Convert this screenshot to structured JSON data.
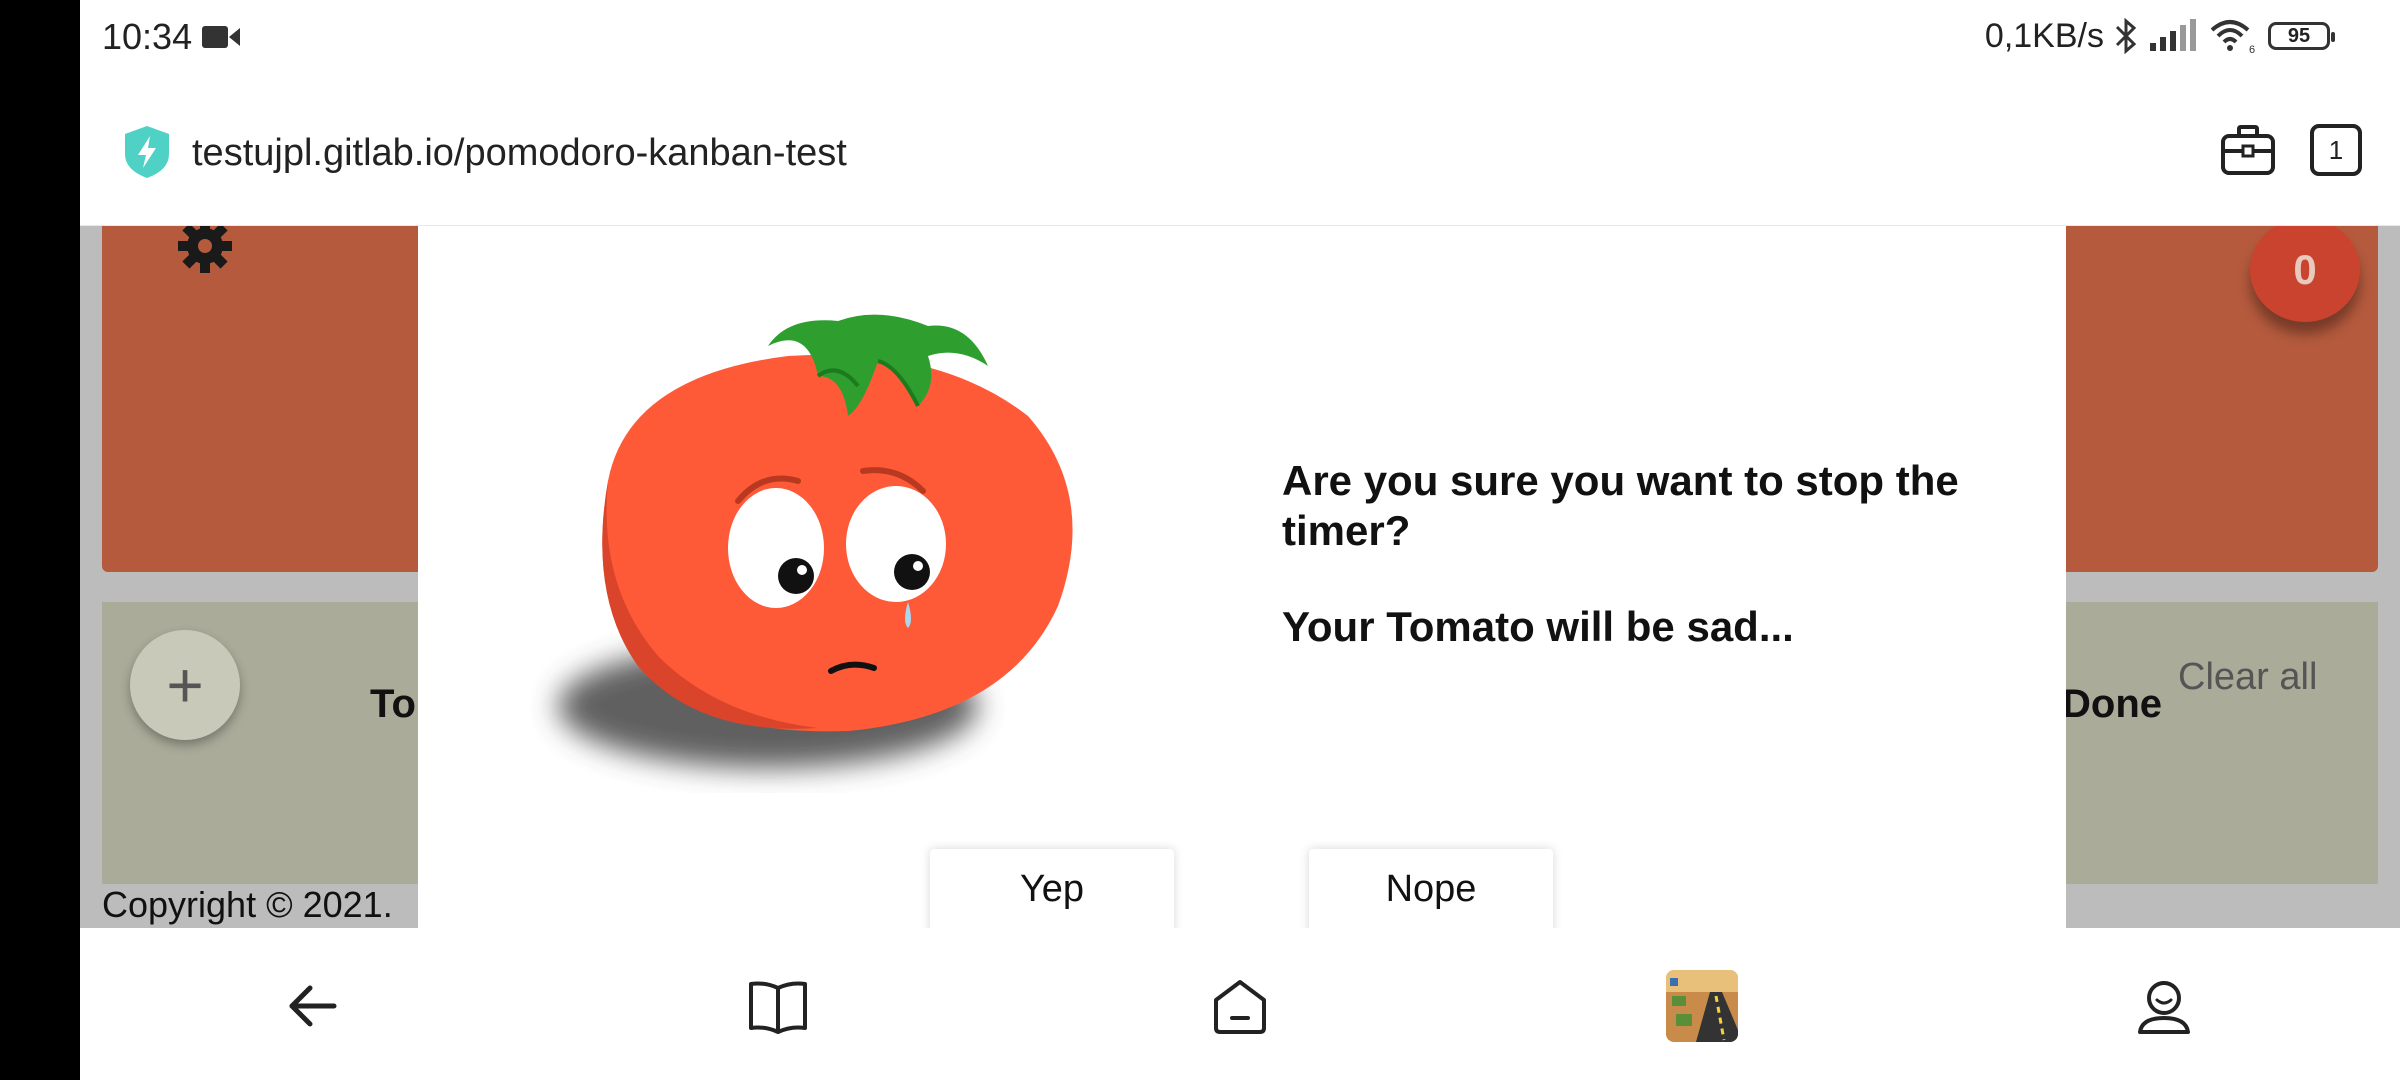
{
  "status_bar": {
    "time": "10:34",
    "net_speed": "0,1KB/s",
    "battery": "95",
    "wifi_badge": "6"
  },
  "browser": {
    "url": "testujpl.gitlab.io/pomodoro-kanban-test",
    "tab_count": "1"
  },
  "page": {
    "counter": "0",
    "add_symbol": "+",
    "todo_title": "To",
    "done_title": "Done",
    "clear_all": "Clear all",
    "copyright": "Copyright © 2021."
  },
  "modal": {
    "question": "Are you sure you want to stop the timer?",
    "subtext": "Your Tomato will be sad...",
    "confirm_label": "Yep",
    "cancel_label": "Nope"
  },
  "colors": {
    "timer_panel": "#b55a3d",
    "board": "#aaab99",
    "tomato": "#ff5a38",
    "shield": "#4fd1c5"
  },
  "icons": [
    "video-icon",
    "bluetooth-icon",
    "signal-icon",
    "wifi-icon",
    "battery-icon",
    "shield-icon",
    "briefcase-icon",
    "gear-icon",
    "back-arrow-icon",
    "book-icon",
    "home-icon",
    "profile-icon"
  ]
}
